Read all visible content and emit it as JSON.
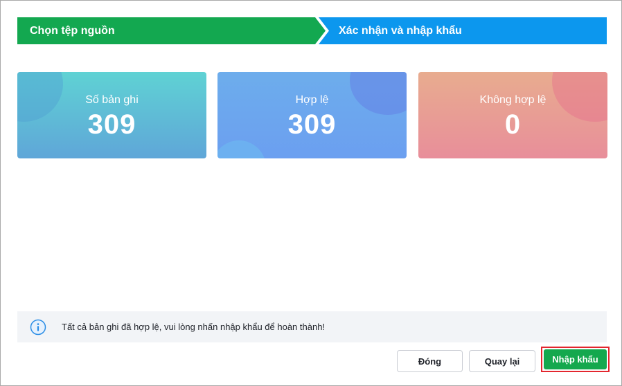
{
  "stepper": {
    "steps": [
      {
        "label": "Chọn tệp nguồn",
        "color": "#13a850"
      },
      {
        "label": "Xác nhận và nhập khẩu",
        "color": "#0c97ee"
      }
    ]
  },
  "stats": {
    "total": {
      "label": "Số bản ghi",
      "value": "309"
    },
    "valid": {
      "label": "Hợp lệ",
      "value": "309"
    },
    "invalid": {
      "label": "Không hợp lệ",
      "value": "0"
    }
  },
  "info": {
    "icon": "info-icon",
    "message": "Tất cả bản ghi đã hợp lệ, vui lòng nhấn nhập khẩu để hoàn thành!"
  },
  "actions": {
    "close_label": "Đóng",
    "back_label": "Quay lại",
    "import_label": "Nhập khẩu"
  },
  "colors": {
    "primary_green": "#14a84e",
    "step_blue": "#0c97ee",
    "highlight_red": "#e3262e"
  }
}
